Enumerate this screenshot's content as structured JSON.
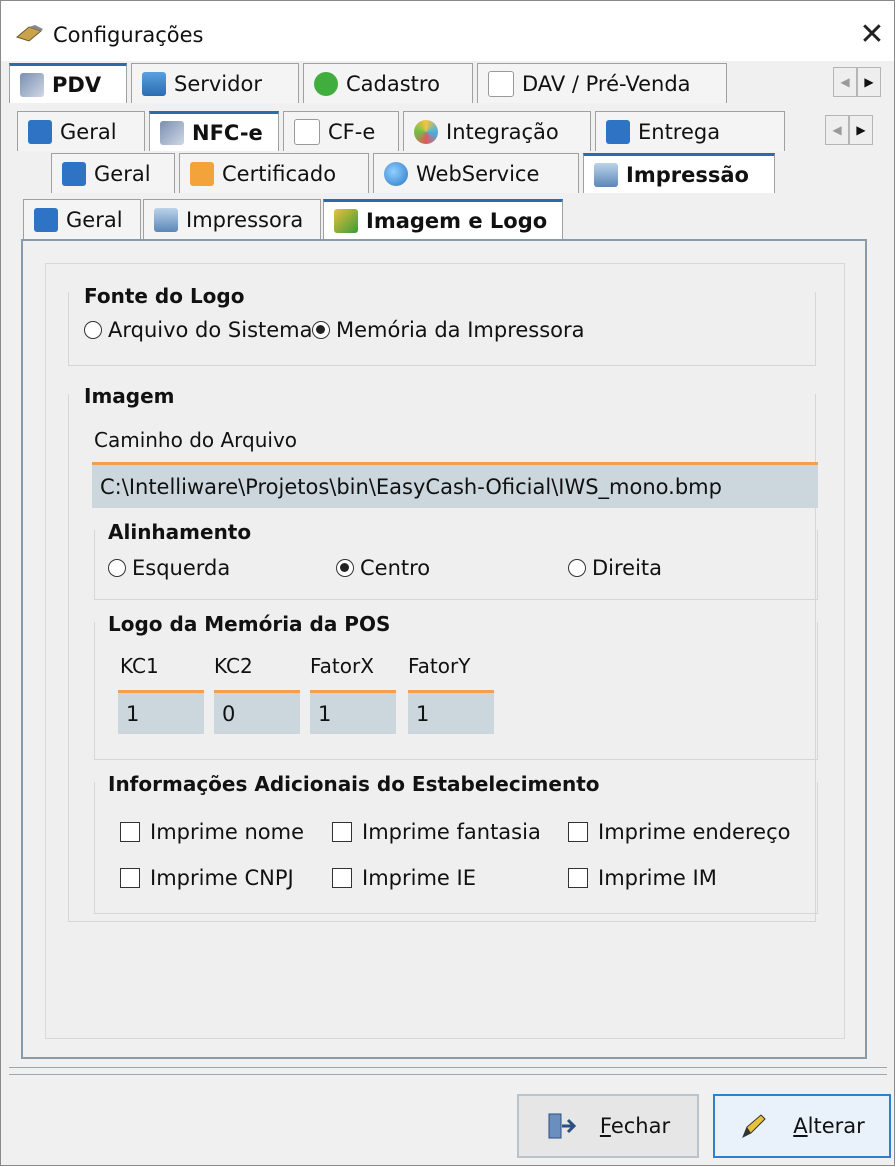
{
  "window": {
    "title": "Configurações",
    "close": "✕"
  },
  "tabs_level1": [
    {
      "label": "PDV",
      "icon": "wrench-tools-icon",
      "active": true
    },
    {
      "label": "Servidor",
      "icon": "database-icon",
      "active": false
    },
    {
      "label": "Cadastro",
      "icon": "plus-circle-icon",
      "active": false
    },
    {
      "label": "DAV / Pré-Venda",
      "icon": "document-icon",
      "active": false
    }
  ],
  "tabs_level2": [
    {
      "label": "Geral",
      "icon": "window-icon"
    },
    {
      "label": "NFC-e",
      "icon": "tools-icon"
    },
    {
      "label": "CF-e",
      "icon": "document-icon"
    },
    {
      "label": "Integração",
      "icon": "integration-icon"
    },
    {
      "label": "Entrega",
      "icon": "truck-icon"
    }
  ],
  "tabs_level3": [
    {
      "label": "Geral",
      "icon": "window-icon"
    },
    {
      "label": "Certificado",
      "icon": "certificate-icon"
    },
    {
      "label": "WebService",
      "icon": "globe-icon"
    },
    {
      "label": "Impressão",
      "icon": "printer-icon"
    }
  ],
  "tabs_level4": [
    {
      "label": "Geral",
      "icon": "window-icon"
    },
    {
      "label": "Impressora",
      "icon": "printer-icon"
    },
    {
      "label": "Imagem e Logo",
      "icon": "image-icon"
    }
  ],
  "fonte_logo": {
    "title": "Fonte do Logo",
    "option1": "Arquivo do Sistema",
    "option2": "Memória da Impressora",
    "selected": "Memória da Impressora"
  },
  "imagem": {
    "title": "Imagem",
    "caminho_label": "Caminho do Arquivo",
    "caminho_value": "C:\\Intelliware\\Projetos\\bin\\EasyCash-Oficial\\IWS_mono.bmp"
  },
  "alinhamento": {
    "title": "Alinhamento",
    "esquerda": "Esquerda",
    "centro": "Centro",
    "direita": "Direita",
    "selected": "Centro"
  },
  "logo_pos": {
    "title": "Logo da Memória da POS",
    "kc1_label": "KC1",
    "kc1_value": "1",
    "kc2_label": "KC2",
    "kc2_value": "0",
    "fatorx_label": "FatorX",
    "fatorx_value": "1",
    "fatory_label": "FatorY",
    "fatory_value": "1"
  },
  "info_adicionais": {
    "title": "Informações Adicionais do Estabelecimento",
    "nome": "Imprime nome",
    "fantasia": "Imprime fantasia",
    "endereco": "Imprime endereço",
    "cnpj": "Imprime CNPJ",
    "ie": "Imprime IE",
    "im": "Imprime IM"
  },
  "buttons": {
    "fechar_rest": "echar",
    "fechar_key": "F",
    "alterar_rest": "lterar",
    "alterar_key": "A"
  },
  "colors": {
    "accent": "#2e7fd0",
    "field_bg": "#ccd6dd",
    "field_border": "#f0a050"
  }
}
